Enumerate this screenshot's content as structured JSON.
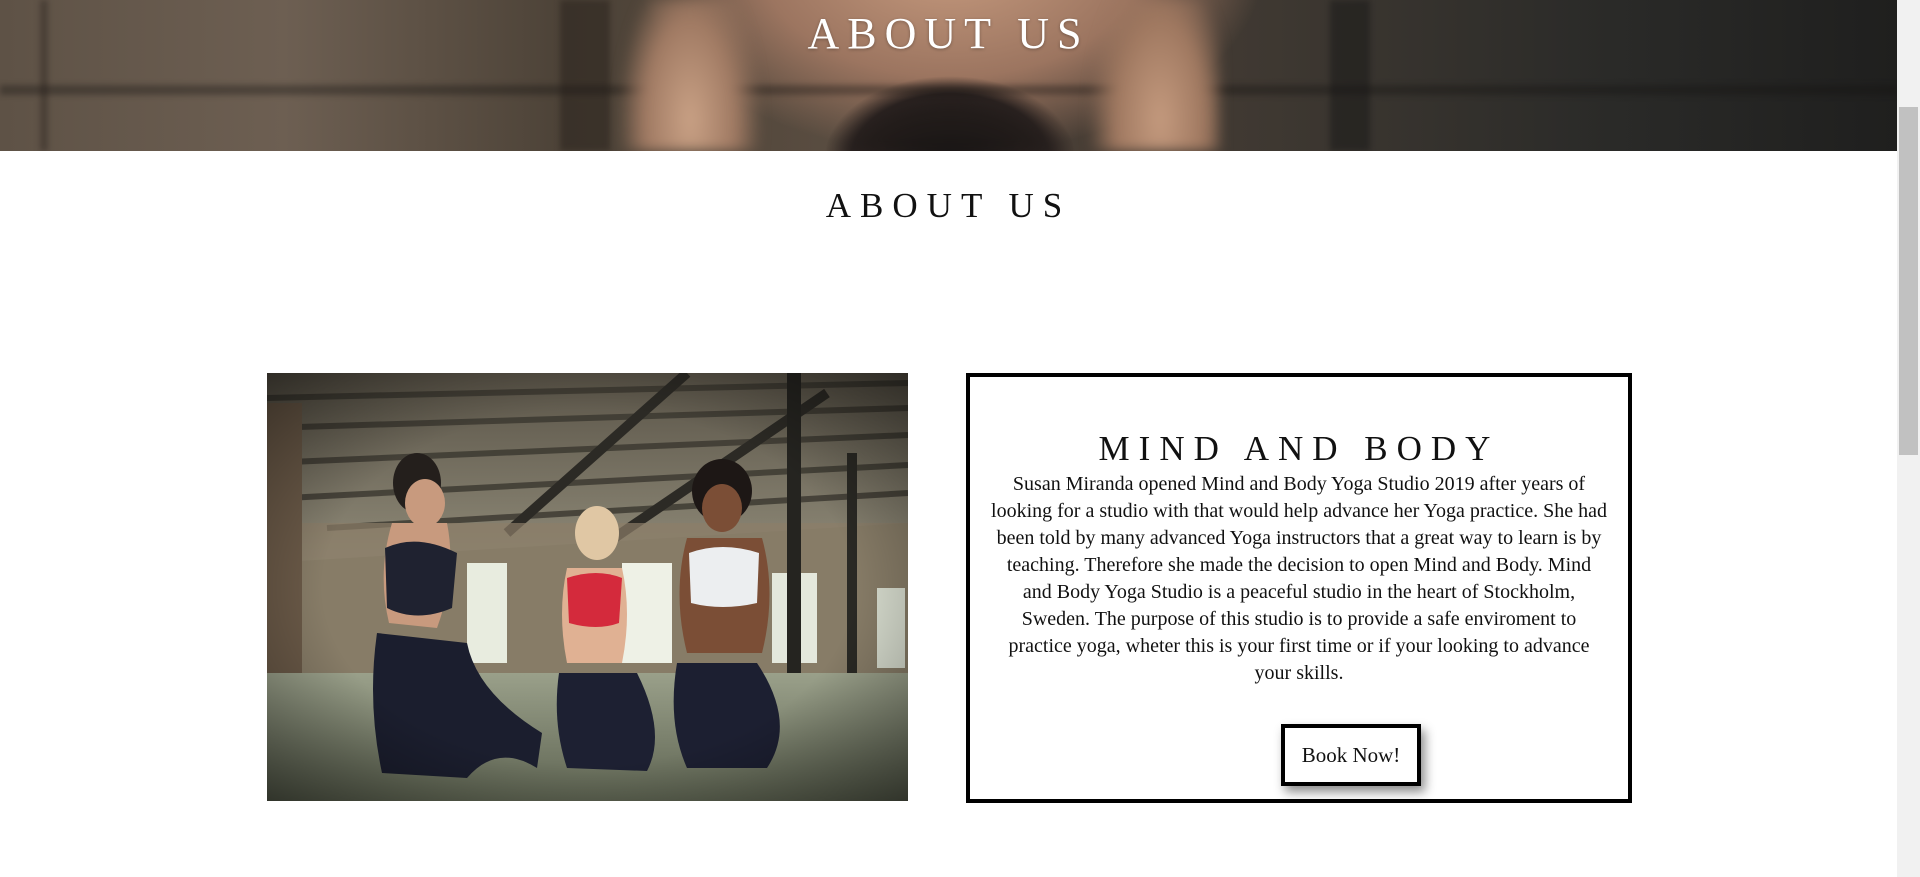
{
  "hero": {
    "title": "ABOUT US"
  },
  "section": {
    "title": "ABOUT US"
  },
  "about_card": {
    "title": "MIND AND BODY",
    "text": "Susan Miranda opened Mind and Body Yoga Studio 2019 after years of looking for a studio with that would help advance her Yoga practice. She had been told by many advanced Yoga instructors that a great way to learn is by teaching. Therefore she made the decision to open Mind and Body. Mind and Body Yoga Studio is a peaceful studio in the heart of Stockholm, Sweden. The purpose of this studio is to provide a safe enviroment to practice yoga, wheter this is your first time or if your looking to advance your skills.",
    "button_label": "Book Now!"
  },
  "photo": {
    "alt": "Three women in yoga outfits kneeling and smiling in a loft studio"
  },
  "colors": {
    "border": "#000000",
    "background": "#ffffff",
    "text": "#111111"
  }
}
